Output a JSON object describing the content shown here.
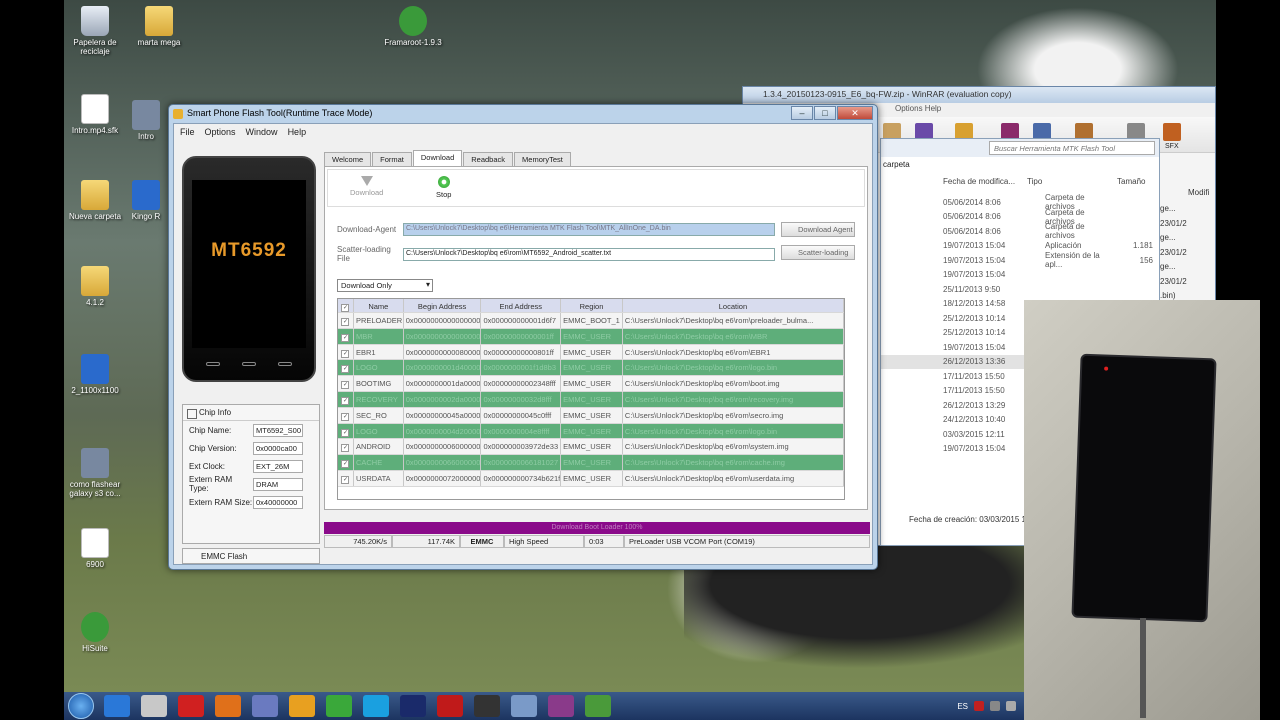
{
  "desktop": {
    "icons": [
      {
        "label": "Papelera de reciclaje"
      },
      {
        "label": "marta mega"
      },
      {
        "label": "Framaroot-1.9.3"
      },
      {
        "label": "Intro.mp4.sfk"
      },
      {
        "label": "Intro"
      },
      {
        "label": "Nueva carpeta"
      },
      {
        "label": "Kingo R"
      },
      {
        "label": "4.1.2"
      },
      {
        "label": "2_1100x1100"
      },
      {
        "label": "como flashear galaxy s3 co..."
      },
      {
        "label": "6900"
      },
      {
        "label": "HiSuite"
      }
    ]
  },
  "flashtool": {
    "title": "Smart Phone Flash Tool(Runtime Trace Mode)",
    "menu": [
      "File",
      "Options",
      "Window",
      "Help"
    ],
    "phone_model": "MT6592",
    "tabs": [
      "Welcome",
      "Format",
      "Download",
      "Readback",
      "MemoryTest"
    ],
    "active_tab": "Download",
    "toolbar": {
      "download": "Download",
      "stop": "Stop"
    },
    "download_agent_label": "Download-Agent",
    "download_agent_value": "C:\\Users\\Unlock7\\Desktop\\bq e6\\Herramienta MTK Flash Tool\\MTK_AllInOne_DA.bin",
    "download_agent_button": "Download Agent",
    "scatter_label": "Scatter-loading File",
    "scatter_value": "C:\\Users\\Unlock7\\Desktop\\bq e6\\rom\\MT6592_Android_scatter.txt",
    "scatter_button": "Scatter-loading",
    "mode": "Download Only",
    "columns": [
      "Name",
      "Begin Address",
      "End Address",
      "Region",
      "Location"
    ],
    "rows": [
      {
        "name": "PRELOADER",
        "begin": "0x0000000000000000",
        "end": "0x000000000001d6f7",
        "region": "EMMC_BOOT_1",
        "loc": "C:\\Users\\Unlock7\\Desktop\\bq e6\\rom\\preloader_bulma...",
        "hl": false
      },
      {
        "name": "MBR",
        "begin": "0x0000000000000000",
        "end": "0x00000000000001ff",
        "region": "EMMC_USER",
        "loc": "C:\\Users\\Unlock7\\Desktop\\bq e6\\rom\\MBR",
        "hl": true
      },
      {
        "name": "EBR1",
        "begin": "0x0000000000080000",
        "end": "0x00000000000801ff",
        "region": "EMMC_USER",
        "loc": "C:\\Users\\Unlock7\\Desktop\\bq e6\\rom\\EBR1",
        "hl": false
      },
      {
        "name": "LOGO",
        "begin": "0x0000000001d40000",
        "end": "0x0000000001f1d8b3",
        "region": "EMMC_USER",
        "loc": "C:\\Users\\Unlock7\\Desktop\\bq e6\\rom\\logo.bin",
        "hl": true
      },
      {
        "name": "BOOTIMG",
        "begin": "0x0000000001da0000",
        "end": "0x00000000002348fff",
        "region": "EMMC_USER",
        "loc": "C:\\Users\\Unlock7\\Desktop\\bq e6\\rom\\boot.img",
        "hl": false
      },
      {
        "name": "RECOVERY",
        "begin": "0x0000000002da0000",
        "end": "0x00000000032d8fff",
        "region": "EMMC_USER",
        "loc": "C:\\Users\\Unlock7\\Desktop\\bq e6\\rom\\recovery.img",
        "hl": true
      },
      {
        "name": "SEC_RO",
        "begin": "0x00000000045a0000",
        "end": "0x00000000045c0fff",
        "region": "EMMC_USER",
        "loc": "C:\\Users\\Unlock7\\Desktop\\bq e6\\rom\\secro.img",
        "hl": false
      },
      {
        "name": "LOGO",
        "begin": "0x0000000004d20000",
        "end": "0x0000000004e8ffff",
        "region": "EMMC_USER",
        "loc": "C:\\Users\\Unlock7\\Desktop\\bq e6\\rom\\logo.bin",
        "hl": true
      },
      {
        "name": "ANDROID",
        "begin": "0x0000000006000000",
        "end": "0x000000003972de33",
        "region": "EMMC_USER",
        "loc": "C:\\Users\\Unlock7\\Desktop\\bq e6\\rom\\system.img",
        "hl": false
      },
      {
        "name": "CACHE",
        "begin": "0x0000000066000000",
        "end": "0x0000000066181027",
        "region": "EMMC_USER",
        "loc": "C:\\Users\\Unlock7\\Desktop\\bq e6\\rom\\cache.img",
        "hl": true
      },
      {
        "name": "USRDATA",
        "begin": "0x0000000072000000",
        "end": "0x000000000734b621f",
        "region": "EMMC_USER",
        "loc": "C:\\Users\\Unlock7\\Desktop\\bq e6\\rom\\userdata.img",
        "hl": false
      }
    ],
    "chip_info": {
      "title": "Chip Info",
      "fields": [
        {
          "label": "Chip Name:",
          "value": "MT6592_S00"
        },
        {
          "label": "Chip Version:",
          "value": "0x0000ca00"
        },
        {
          "label": "Ext Clock:",
          "value": "EXT_26M"
        },
        {
          "label": "Extern RAM Type:",
          "value": "DRAM"
        },
        {
          "label": "Extern RAM Size:",
          "value": "0x40000000"
        }
      ]
    },
    "emmc_flash": "EMMC Flash",
    "progress_text": "Download Boot Loader 100%",
    "status": [
      "745.20K/s",
      "117.74K",
      "EMMC",
      "High Speed",
      "0:03",
      "PreLoader USB VCOM Port (COM19)"
    ]
  },
  "winrar": {
    "title": "1.3.4_20150123-0915_E6_bq-FW.zip - WinRAR (evaluation copy)",
    "menu": "Options  Help",
    "sfx": "SFX",
    "search_placeholder": "Buscar Herramienta MTK Flash Tool",
    "crumb": "carpeta",
    "col_date": "Fecha de modifica...",
    "col_type": "Tipo",
    "col_size": "Tamaño",
    "col_mod": "Modifi",
    "rows": [
      {
        "date": "05/06/2014 8:06",
        "type": "Carpeta de archivos",
        "size": ""
      },
      {
        "date": "05/06/2014 8:06",
        "type": "Carpeta de archivos",
        "size": ""
      },
      {
        "date": "05/06/2014 8:06",
        "type": "Carpeta de archivos",
        "size": ""
      },
      {
        "date": "19/07/2013 15:04",
        "type": "Aplicación",
        "size": "1.181"
      },
      {
        "date": "19/07/2013 15:04",
        "type": "Extensión de la apl...",
        "size": "156"
      },
      {
        "date": "19/07/2013 15:04",
        "type": "",
        "size": ""
      },
      {
        "date": "25/11/2013 9:50",
        "type": "",
        "size": ""
      },
      {
        "date": "18/12/2013 14:58",
        "type": "",
        "size": ""
      },
      {
        "date": "25/12/2013 10:14",
        "type": "",
        "size": ""
      },
      {
        "date": "25/12/2013 10:14",
        "type": "",
        "size": ""
      },
      {
        "date": "19/07/2013 15:04",
        "type": "",
        "size": ""
      },
      {
        "date": "26/12/2013 13:36",
        "type": "",
        "size": ""
      },
      {
        "date": "17/11/2013 15:50",
        "type": "",
        "size": ""
      },
      {
        "date": "17/11/2013 15:50",
        "type": "",
        "size": ""
      },
      {
        "date": "26/12/2013 13:29",
        "type": "",
        "size": ""
      },
      {
        "date": "24/12/2013 10:40",
        "type": "",
        "size": ""
      },
      {
        "date": "03/03/2015 12:11",
        "type": "",
        "size": ""
      },
      {
        "date": "19/07/2013 15:04",
        "type": "",
        "size": ""
      }
    ],
    "side_col": [
      "ge...",
      "23/01/2",
      "ge...",
      "23/01/2",
      "ge...",
      "23/01/2",
      ".bin)",
      "23/01/2",
      ".bin)",
      "23/01/2"
    ],
    "footer": "Fecha de creación: 03/03/2015 1"
  },
  "taskbar": {
    "lang": "ES"
  },
  "colors": {
    "progress": "#8a0a8a",
    "highlight_row": "#5eae7a",
    "accent_model": "#e89a2a"
  }
}
